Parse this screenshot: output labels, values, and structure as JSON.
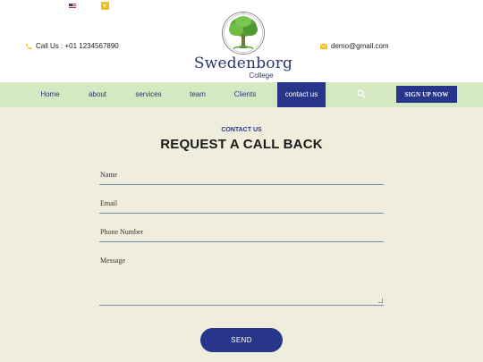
{
  "header": {
    "call_text": "Call Us : +01 1234567890",
    "email_text": "demo@gmail.com",
    "logo_name": "Swedenborg",
    "logo_sub": "College"
  },
  "nav": {
    "items": [
      {
        "label": "Home",
        "active": false
      },
      {
        "label": "about",
        "active": false
      },
      {
        "label": "services",
        "active": false
      },
      {
        "label": "team",
        "active": false
      },
      {
        "label": "Clients",
        "active": false
      },
      {
        "label": "contact us",
        "active": true
      }
    ],
    "signup_label": "SIGN UP NOW"
  },
  "form": {
    "eyebrow": "CONTACT US",
    "title": "REQUEST A CALL BACK",
    "fields": [
      {
        "placeholder": "Name",
        "value": ""
      },
      {
        "placeholder": "Email",
        "value": ""
      },
      {
        "placeholder": "Phone Number",
        "value": ""
      },
      {
        "placeholder": "Message",
        "value": ""
      }
    ],
    "submit_label": "SEND"
  },
  "colors": {
    "brand": "#27358a",
    "nav_bg": "#d4e9c2",
    "page_bg": "#efeedd",
    "accent_icon": "#f2c21b",
    "tree_green": "#5aa83a"
  },
  "icons": {
    "language": "us-flag-icon",
    "language_toggle": "dropdown-icon",
    "phone": "phone-icon",
    "email": "mail-icon",
    "search": "search-icon"
  }
}
